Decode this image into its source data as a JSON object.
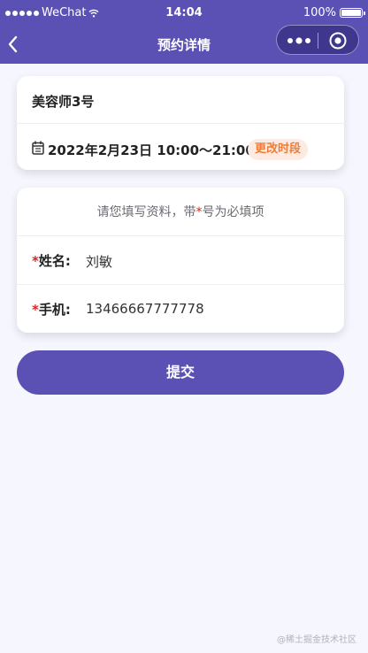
{
  "status_bar": {
    "carrier": "WeChat",
    "time": "14:04",
    "battery_text": "100%",
    "battery_level": 1.0,
    "icons": [
      "signal-dots-icon",
      "wifi-icon",
      "battery-icon"
    ]
  },
  "nav": {
    "title": "预约详情",
    "icons": [
      "back-arrow-icon",
      "more-dots-icon",
      "close-target-icon"
    ]
  },
  "appointment": {
    "stylist_name": "美容师3号",
    "date_time": "2022年2月23日 10:00～21:00",
    "change_button": "更改时段",
    "icons": [
      "calendar-icon"
    ]
  },
  "form": {
    "hint_before": "请您填写资料，带",
    "hint_star": "*",
    "hint_after": "号为必填项",
    "name_required_mark": "*",
    "name_label": "姓名:",
    "name_value": "刘敏",
    "phone_required_mark": "*",
    "phone_label": "手机:",
    "phone_value": "13466667777778"
  },
  "submit_button": "提交",
  "watermark": "@稀土掘金技术社区",
  "colors": {
    "primary": "#5b51b5",
    "page_background": "#f6f6fe",
    "badge_background": "#fdebe1",
    "badge_text": "#ef7d3a",
    "required_mark": "#e02020"
  }
}
